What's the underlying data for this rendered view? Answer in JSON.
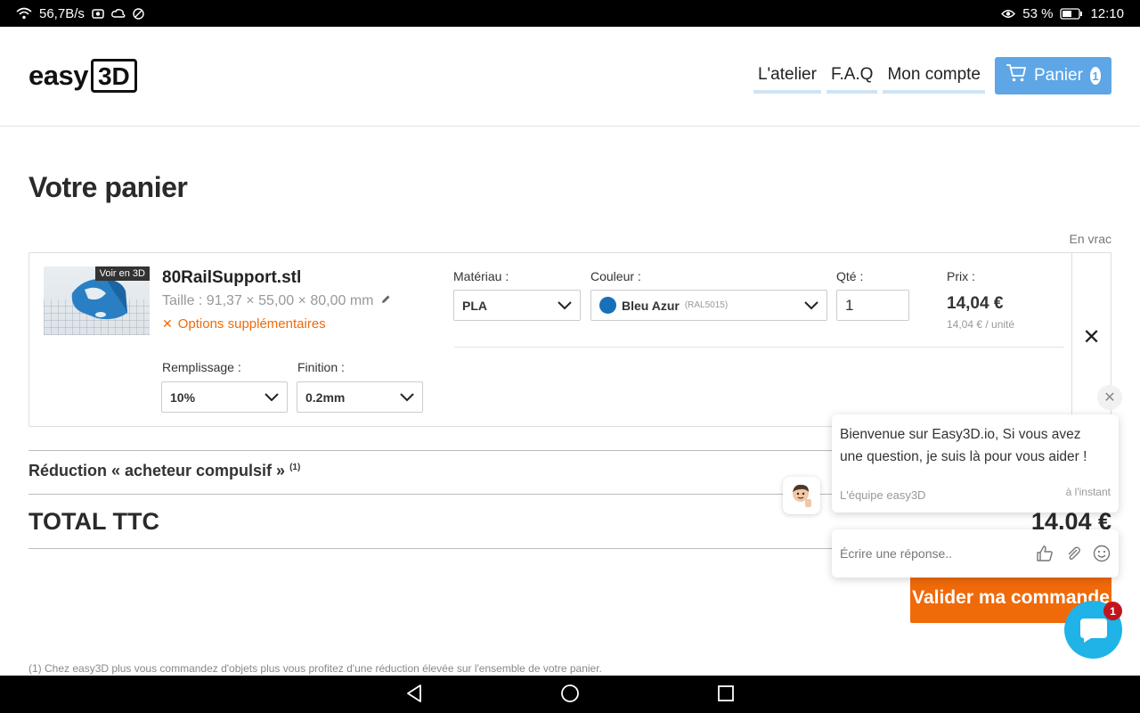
{
  "statusbar": {
    "speed": "56,7B/s",
    "battery": "53 %",
    "time": "12:10"
  },
  "header": {
    "logo_text": "easy",
    "logo_box": "3D",
    "nav": [
      "L'atelier",
      "F.A.Q",
      "Mon compte"
    ],
    "cart_label": "Panier",
    "cart_count": "1"
  },
  "page": {
    "title": "Votre panier",
    "bulk_label": "En vrac"
  },
  "item": {
    "thumb_badge": "Voir en 3D",
    "filename": "80RailSupport.stl",
    "size": "Taille : 91,37 × 55,00 × 80,00 mm",
    "extra_options": "Options supplémentaires",
    "material_label": "Matériau :",
    "material_value": "PLA",
    "color_label": "Couleur :",
    "color_value": "Bleu Azur",
    "color_code": "(RAL5015)",
    "color_hex": "#1870b8",
    "qty_label": "Qté :",
    "qty_value": "1",
    "price_label": "Prix :",
    "price": "14,04 €",
    "unit_price": "14,04 € / unité",
    "infill_label": "Remplissage :",
    "infill_value": "10%",
    "finish_label": "Finition :",
    "finish_value": "0.2mm",
    "remove_label": "✕"
  },
  "summary": {
    "discount_label": "Réduction « acheteur compulsif »",
    "discount_note": "(1)",
    "total_label": "TOTAL TTC",
    "total_value": "14,04 €",
    "validate_label": "Valider ma commande",
    "footnote": "(1) Chez easy3D plus vous commandez d'objets plus vous profitez d'une réduction élevée sur l'ensemble de votre panier."
  },
  "chat": {
    "message": "Bienvenue sur Easy3D.io, Si vous avez une question, je suis là pour vous aider !",
    "team": "L'équipe easy3D",
    "time": "à l'instant",
    "reply_placeholder": "Écrire une réponse..",
    "unread": "1"
  },
  "colors": {
    "accent_blue": "#5ea6e6",
    "orange": "#f06a0a",
    "chat_blue": "#1fb3e8",
    "badge_red": "#c0161e"
  }
}
